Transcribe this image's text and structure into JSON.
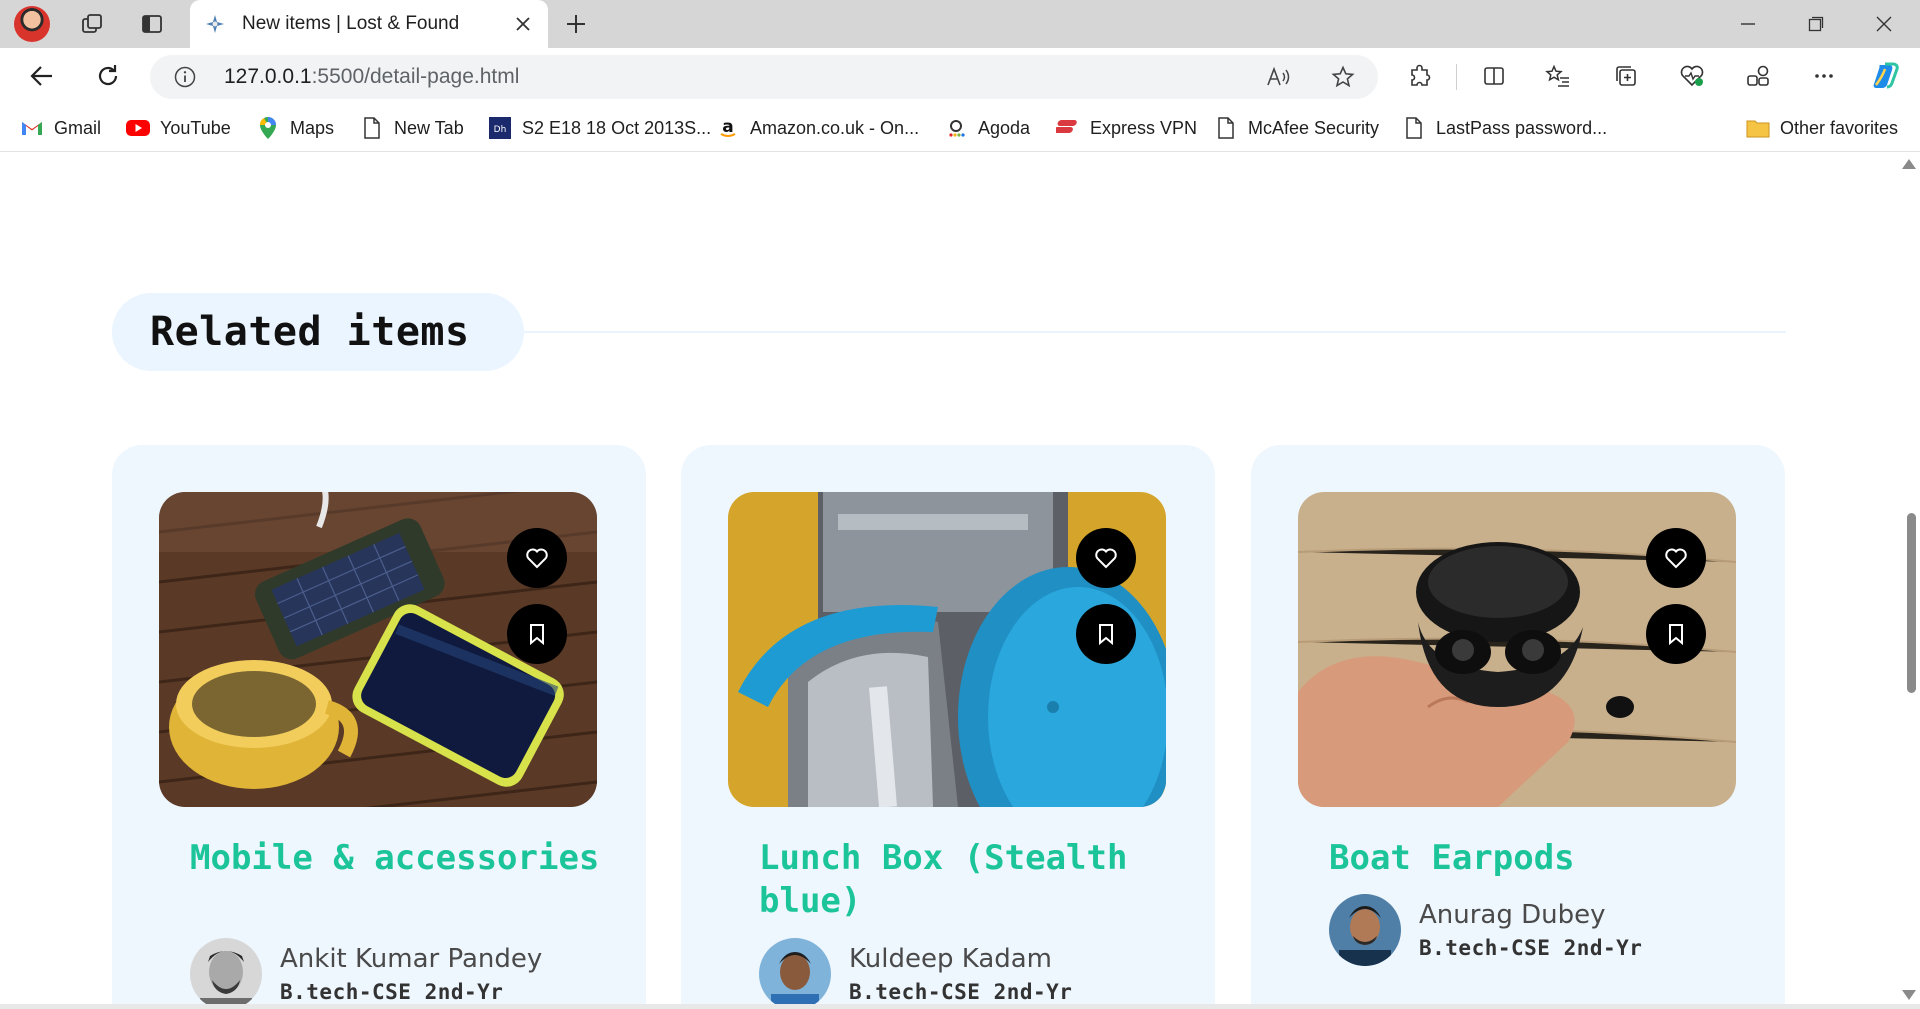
{
  "browser": {
    "tab_title": "New items | Lost & Found",
    "url_host": "127.0.0.1",
    "url_path": ":5500/detail-page.html",
    "bookmarks": [
      {
        "label": "Gmail",
        "icon": "gmail-icon"
      },
      {
        "label": "YouTube",
        "icon": "youtube-icon"
      },
      {
        "label": "Maps",
        "icon": "maps-icon"
      },
      {
        "label": "New Tab",
        "icon": "page-icon"
      },
      {
        "label": "S2 E18 18 Oct 2013S...",
        "icon": "dh-icon"
      },
      {
        "label": "Amazon.co.uk - On...",
        "icon": "amazon-icon"
      },
      {
        "label": "Agoda",
        "icon": "agoda-icon"
      },
      {
        "label": "Express VPN",
        "icon": "expressvpn-icon"
      },
      {
        "label": "McAfee Security",
        "icon": "page-icon"
      },
      {
        "label": "LastPass password...",
        "icon": "page-icon"
      }
    ],
    "other_favorites": "Other favorites"
  },
  "section": {
    "title": "Related items"
  },
  "items": [
    {
      "title": "Mobile & accessories",
      "owner_name": "Ankit Kumar Pandey",
      "owner_meta": "B.tech-CSE 2nd-Yr",
      "image": "solar-powerbank-phone-mug-photo"
    },
    {
      "title": "Lunch Box (Stealth blue)",
      "owner_name": "Kuldeep Kadam",
      "owner_meta": "B.tech-CSE 2nd-Yr",
      "image": "lunch-box-photo"
    },
    {
      "title": "Boat Earpods",
      "owner_name": "Anurag Dubey",
      "owner_meta": "B.tech-CSE 2nd-Yr",
      "image": "earbuds-case-photo"
    }
  ],
  "colors": {
    "accent": "#1cc49a",
    "card_bg": "#eef6fe",
    "heading_pill": "#eaf5ff"
  }
}
